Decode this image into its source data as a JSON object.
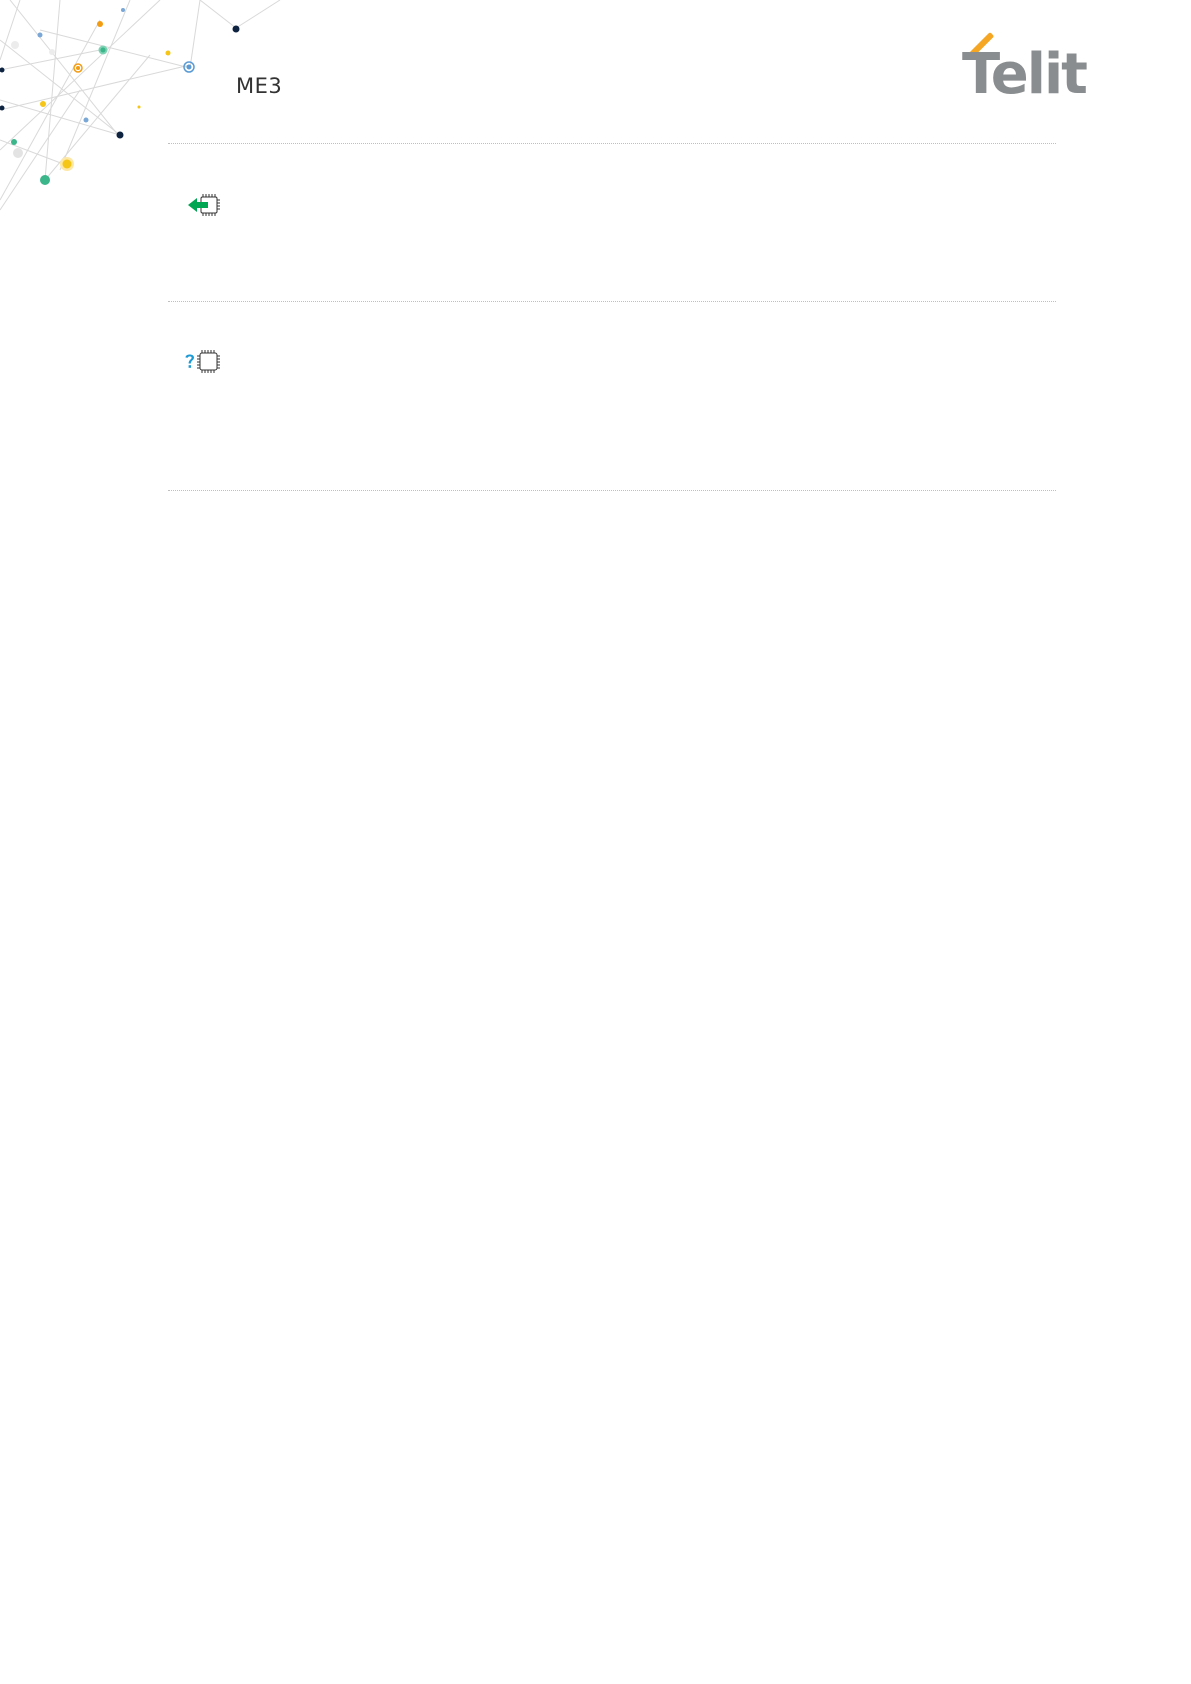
{
  "header": {
    "doc_title": "ME3",
    "logo_text": "Telit"
  },
  "icons": {
    "set_command": "arrow-into-chip-icon",
    "read_command": "question-chip-icon"
  },
  "colors": {
    "accent_orange": "#f5a623",
    "logo_gray": "#8a8d8f",
    "set_arrow_green": "#00a651",
    "read_question_blue": "#1b9ad6",
    "divider": "#bfbfbf"
  }
}
